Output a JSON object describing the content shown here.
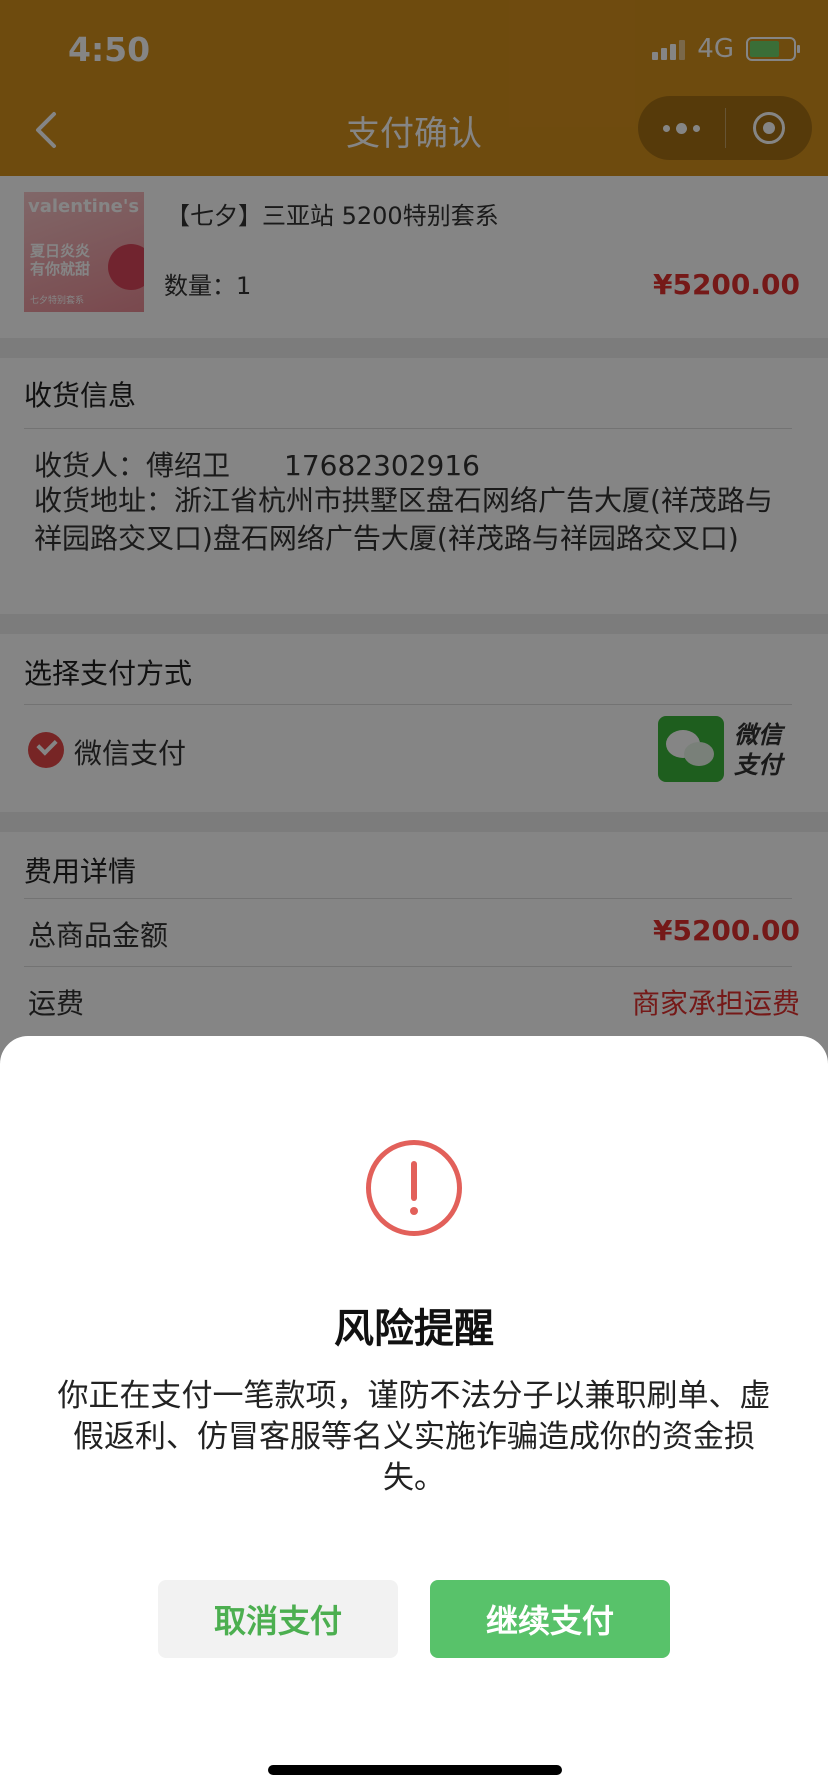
{
  "status": {
    "time": "4:50",
    "network": "4G"
  },
  "nav": {
    "title": "支付确认"
  },
  "product": {
    "thumb_lines": [
      "valentine's",
      "夏日炎炎",
      "有你就甜",
      "七夕特别套系"
    ],
    "name": "【七夕】三亚站 5200特别套系",
    "qty_label": "数量：1",
    "price": "¥5200.00"
  },
  "shipping": {
    "title": "收货信息",
    "receiver": "收货人：傅绍卫",
    "phone": "17682302916",
    "address": "收货地址：浙江省杭州市拱墅区盘石网络广告大厦(祥茂路与祥园路交叉口)盘石网络广告大厦(祥茂路与祥园路交叉口)"
  },
  "payment": {
    "title": "选择支付方式",
    "method": "微信支付",
    "logo_text_1": "微信",
    "logo_text_2": "支付"
  },
  "fees": {
    "title": "费用详情",
    "total_label": "总商品金额",
    "total_value": "¥5200.00",
    "shipping_label": "运费",
    "shipping_value": "商家承担运费"
  },
  "modal": {
    "title": "风险提醒",
    "body": "你正在支付一笔款项，谨防不法分子以兼职刷单、虚假返利、仿冒客服等名义实施诈骗造成你的资金损失。",
    "cancel_label": "取消支付",
    "continue_label": "继续支付"
  },
  "colors": {
    "nav_bg": "#d4901c",
    "price_red": "#e0312e",
    "warn_red": "#e2605a",
    "wechat_green": "#58c26a"
  }
}
